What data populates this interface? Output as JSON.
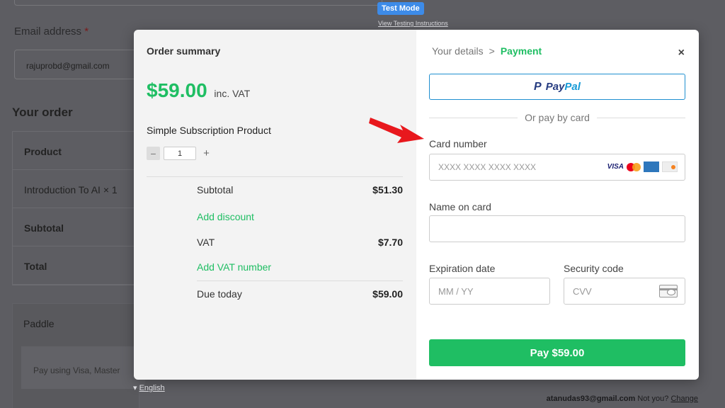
{
  "background": {
    "email_label": "Email address",
    "required_marker": "*",
    "email_value": "rajuprobd@gmail.com",
    "your_order_heading": "Your order",
    "order_rows": [
      "Product",
      "Introduction To AI  × 1",
      "Subtotal",
      "Total"
    ],
    "paddle_label": "Paddle",
    "paddle_sub": "Pay using Visa, Master"
  },
  "test_mode": {
    "badge": "Test Mode",
    "link": "View Testing Instructions"
  },
  "language": {
    "arrow": "▾",
    "label": "English"
  },
  "footer": {
    "email": "atanudas93@gmail.com",
    "not_you": "Not you?",
    "change": "Change"
  },
  "order_summary": {
    "title": "Order summary",
    "price": "$59.00",
    "price_suffix": "inc. VAT",
    "product_name": "Simple Subscription Product",
    "quantity": "1",
    "minus": "−",
    "plus": "+",
    "subtotal_label": "Subtotal",
    "subtotal_value": "$51.30",
    "add_discount": "Add discount",
    "vat_label": "VAT",
    "vat_value": "$7.70",
    "add_vat_number": "Add VAT number",
    "due_label": "Due today",
    "due_value": "$59.00"
  },
  "payment": {
    "breadcrumb_step1": "Your details",
    "breadcrumb_sep": ">",
    "breadcrumb_step2": "Payment",
    "close": "×",
    "paypal_pay": "Pay",
    "paypal_pal": "Pal",
    "or_text": "Or pay by card",
    "card_number_label": "Card number",
    "card_number_placeholder": "XXXX XXXX XXXX XXXX",
    "card_brand_visa": "VISA",
    "name_label": "Name on card",
    "name_value": "",
    "expiry_label": "Expiration date",
    "expiry_placeholder": "MM / YY",
    "security_label": "Security code",
    "security_placeholder": "CVV",
    "pay_button": "Pay $59.00"
  },
  "colors": {
    "accent_green": "#1fbe63",
    "paypal_border": "#1f8fd0",
    "arrow_red": "#e8181d"
  }
}
